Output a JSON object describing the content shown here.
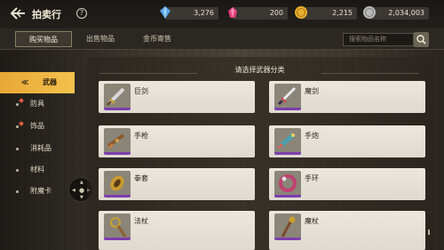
{
  "header": {
    "title": "拍卖行",
    "help": "?",
    "currencies": [
      {
        "icon": "blue-diamond-icon",
        "value": "3,276",
        "color": "#5aa6e8"
      },
      {
        "icon": "pink-gem-icon",
        "value": "200",
        "color": "#e0407a"
      },
      {
        "icon": "gold-coin-icon",
        "value": "2,215",
        "color": "#e8b030"
      },
      {
        "icon": "silver-coin-icon",
        "value": "2,034,003",
        "color": "#b8b8b8"
      }
    ]
  },
  "tabs": [
    "购买物品",
    "出售物品",
    "金币寄售"
  ],
  "search": {
    "placeholder": "搜索物品名称"
  },
  "sidebar": {
    "items": [
      {
        "label": "武器",
        "active": true
      },
      {
        "label": "防具",
        "active": false
      },
      {
        "label": "饰品",
        "active": false
      },
      {
        "label": "消耗品",
        "active": false
      },
      {
        "label": "材料",
        "active": false
      },
      {
        "label": "附魔卡",
        "active": false
      }
    ]
  },
  "main": {
    "heading": "请选择武器分类",
    "categories": [
      {
        "label": "巨剑",
        "icon": "greatsword-icon"
      },
      {
        "label": "魔剑",
        "icon": "magic-sword-icon"
      },
      {
        "label": "手枪",
        "icon": "pistol-icon"
      },
      {
        "label": "手炮",
        "icon": "hand-cannon-icon"
      },
      {
        "label": "拳套",
        "icon": "gauntlet-icon"
      },
      {
        "label": "手环",
        "icon": "bracelet-icon"
      },
      {
        "label": "法杖",
        "icon": "staff-icon"
      },
      {
        "label": "魔杖",
        "icon": "wand-icon"
      }
    ]
  },
  "colors": {
    "accent": "#f0b440",
    "card_border": "#7b3fae"
  }
}
